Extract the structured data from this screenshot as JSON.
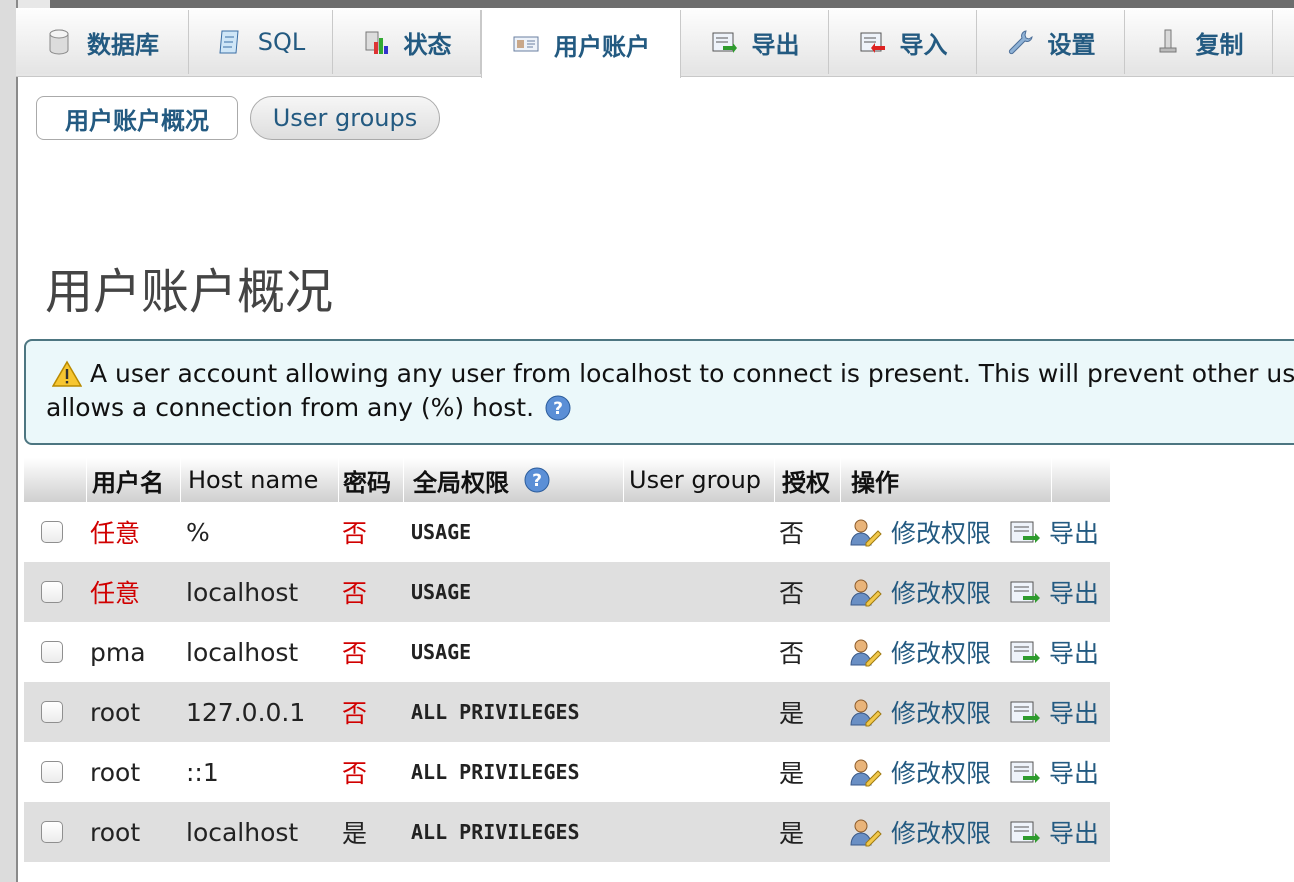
{
  "tabs": [
    {
      "label": "数据库",
      "icon": "database-icon"
    },
    {
      "label": "SQL",
      "icon": "sql-icon"
    },
    {
      "label": "状态",
      "icon": "status-icon"
    },
    {
      "label": "用户账户",
      "icon": "user-accounts-icon"
    },
    {
      "label": "导出",
      "icon": "export-icon"
    },
    {
      "label": "导入",
      "icon": "import-icon"
    },
    {
      "label": "设置",
      "icon": "settings-wrench-icon"
    },
    {
      "label": "复制",
      "icon": "replication-icon"
    }
  ],
  "active_tab": "用户账户",
  "subtabs": {
    "overview": "用户账户概况",
    "groups": "User groups"
  },
  "page_title": "用户账户概况",
  "notice": {
    "line1": "A user account allowing any user from localhost to connect is present. This will prevent other use",
    "line2": "allows a connection from any (%) host."
  },
  "table": {
    "headers": {
      "username": "用户名",
      "host": "Host name",
      "password": "密码",
      "global_priv": "全局权限",
      "user_group": "User group",
      "grant": "授权",
      "action": "操作"
    },
    "rows": [
      {
        "user": "任意",
        "host": "%",
        "password": "否",
        "priv": "USAGE",
        "group": "",
        "grant": "否",
        "edit": "修改权限",
        "export": "导出"
      },
      {
        "user": "任意",
        "host": "localhost",
        "password": "否",
        "priv": "USAGE",
        "group": "",
        "grant": "否",
        "edit": "修改权限",
        "export": "导出"
      },
      {
        "user": "pma",
        "host": "localhost",
        "password": "否",
        "priv": "USAGE",
        "group": "",
        "grant": "否",
        "edit": "修改权限",
        "export": "导出"
      },
      {
        "user": "root",
        "host": "127.0.0.1",
        "password": "否",
        "priv": "ALL PRIVILEGES",
        "group": "",
        "grant": "是",
        "edit": "修改权限",
        "export": "导出"
      },
      {
        "user": "root",
        "host": "::1",
        "password": "否",
        "priv": "ALL PRIVILEGES",
        "group": "",
        "grant": "是",
        "edit": "修改权限",
        "export": "导出"
      },
      {
        "user": "root",
        "host": "localhost",
        "password": "是",
        "priv": "ALL PRIVILEGES",
        "group": "",
        "grant": "是",
        "edit": "修改权限",
        "export": "导出"
      }
    ]
  },
  "colors": {
    "link": "#235a81",
    "red": "#d00000",
    "notice_bg": "#ebf8fa",
    "notice_border": "#4d7681"
  }
}
